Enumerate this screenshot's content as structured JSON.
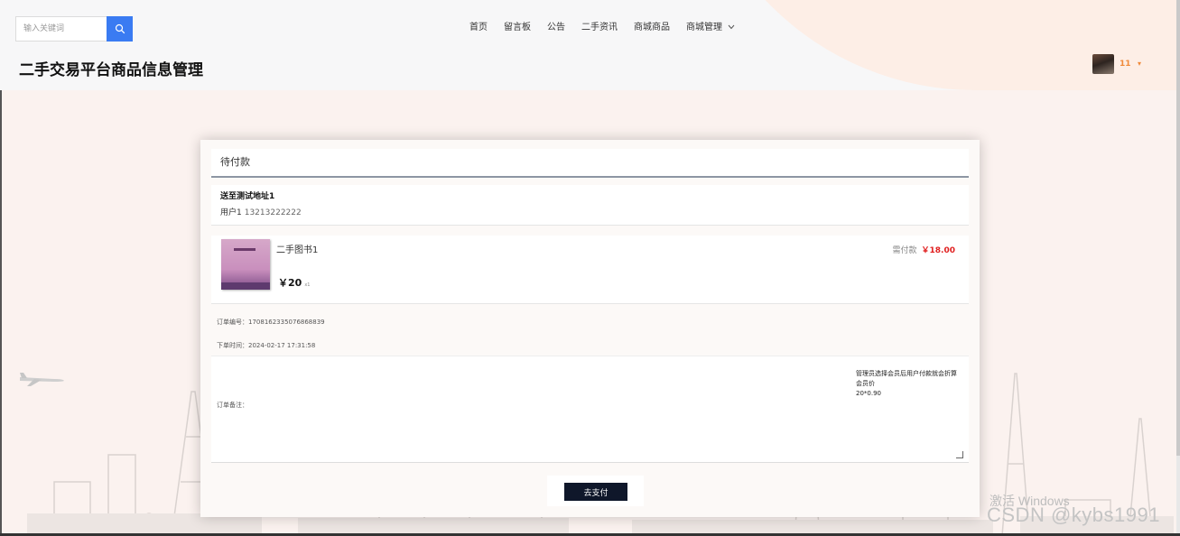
{
  "search": {
    "placeholder": "输入关键词"
  },
  "nav": {
    "items": [
      "首页",
      "留言板",
      "公告",
      "二手资讯",
      "商城商品"
    ],
    "manage_label": "商城管理"
  },
  "site_title": "二手交易平台商品信息管理",
  "user": {
    "name": "11"
  },
  "order": {
    "status_title": "待付款",
    "address_line": "送至测试地址1",
    "receiver": "用户1",
    "phone": "13213222222",
    "product_name": "二手图书1",
    "price": "￥20",
    "qty": "x1",
    "need_pay_label": "需付款",
    "need_pay_amount": "￥18.00",
    "order_no_label": "订单编号：",
    "order_no": "1708162335076868839",
    "order_time_label": "下单时间：",
    "order_time": "2024-02-17 17:31:58",
    "remark_label": "订单备注：",
    "remark_text": "管理员选择会员后用户付款就会折算会员价\n20*0.90",
    "pay_button": "去支付"
  },
  "watermark": {
    "line1": "激活 Windows",
    "line2": "CSDN @kybs1991"
  },
  "icons": {
    "search": "search-icon",
    "caret": "chevron-down-icon",
    "plane": "plane-icon"
  },
  "colors": {
    "accent": "#3a7bf2",
    "price_red": "#e02020",
    "user_orange": "#f08a3a",
    "button_dark": "#0f172a"
  }
}
